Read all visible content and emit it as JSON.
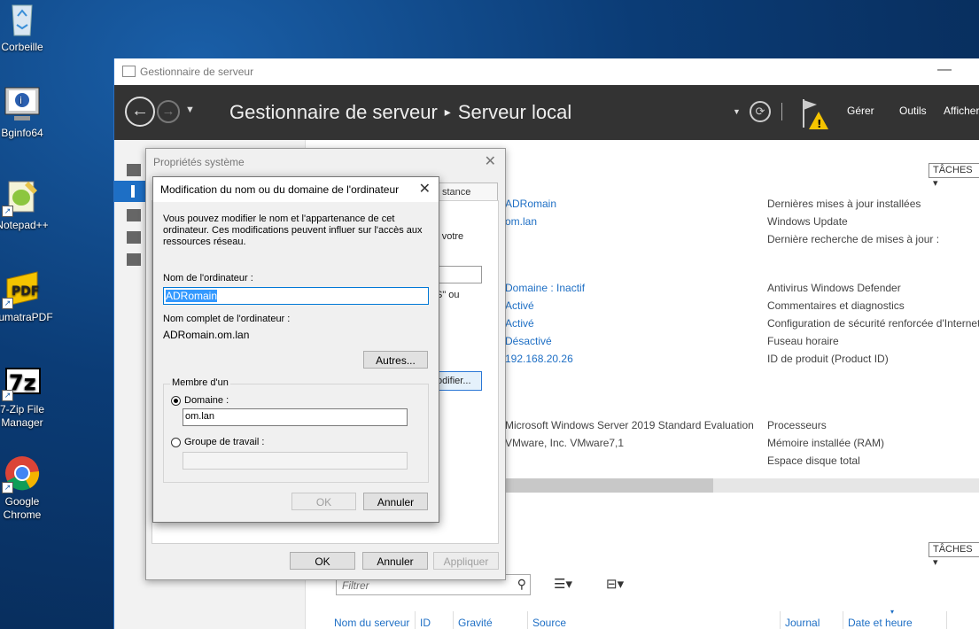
{
  "desktop": {
    "icons": [
      {
        "label": "Corbeille"
      },
      {
        "label": "Bginfo64"
      },
      {
        "label": "Notepad++"
      },
      {
        "label": "SumatraPDF"
      },
      {
        "label": "7-Zip File\nManager"
      },
      {
        "label": "Google Chrome"
      }
    ]
  },
  "server_manager": {
    "title": "Gestionnaire de serveur",
    "min_glyph": "—",
    "breadcrumb": {
      "root": "Gestionnaire de serveur",
      "sep": "▸",
      "current": "Serveur local"
    },
    "menu": {
      "gerer": "Gérer",
      "outils": "Outils",
      "afficher": "Afficher"
    },
    "tasks_label": "TÂCHES",
    "properties_values": [
      "ADRomain",
      "om.lan",
      "Domaine : Inactif",
      "Activé",
      "Activé",
      "Désactivé",
      "192.168.20.26",
      "Microsoft Windows Server 2019 Standard Evaluation",
      "VMware, Inc. VMware7,1"
    ],
    "properties_labels": [
      "Dernières mises à jour installées",
      "Windows Update",
      "Dernière recherche de mises à jour :",
      "Antivirus Windows Defender",
      "Commentaires et diagnostics",
      "Configuration de sécurité renforcée d'Internet",
      "Fuseau horaire",
      "ID de produit (Product ID)",
      "Processeurs",
      "Mémoire installée (RAM)",
      "Espace disque total"
    ],
    "events": {
      "filter_placeholder": "Filtrer",
      "columns": [
        "Nom du serveur",
        "ID",
        "Gravité",
        "Source",
        "Journal",
        "Date et heure"
      ]
    }
  },
  "system_properties": {
    "title": "Propriétés système",
    "tab_fragment": "stance",
    "text_fragments": [
      "r votre",
      "S\" ou"
    ],
    "modify_fragment": "odifier...",
    "buttons": {
      "ok": "OK",
      "cancel": "Annuler",
      "apply": "Appliquer"
    }
  },
  "rename_dialog": {
    "title": "Modification du nom ou du domaine de l'ordinateur",
    "description": "Vous pouvez modifier le nom et l'appartenance de cet ordinateur. Ces modifications peuvent influer sur l'accès aux ressources réseau.",
    "computer_name_label": "Nom de l'ordinateur :",
    "computer_name_value": "ADRomain",
    "full_name_label": "Nom complet de l'ordinateur :",
    "full_name_value": "ADRomain.om.lan",
    "more_button": "Autres...",
    "member_of_label": "Membre d'un",
    "domain_label": "Domaine :",
    "domain_value": "om.lan",
    "workgroup_label": "Groupe de travail :",
    "workgroup_value": "",
    "ok_button": "OK",
    "cancel_button": "Annuler"
  }
}
